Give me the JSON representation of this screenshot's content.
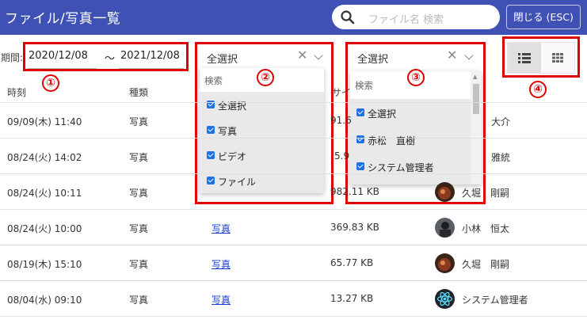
{
  "header": {
    "title": "ファイル/写真一覧",
    "search_placeholder": "ファイル名 検索",
    "close_label": "閉じる (ESC)"
  },
  "filters": {
    "period_label": "期間:",
    "date_from": "2020/12/08",
    "tilde": "～",
    "date_to": "2021/12/08",
    "type_filter": {
      "selected": "全選択",
      "search_placeholder": "検索",
      "options": [
        "全選択",
        "写真",
        "ビデオ",
        "ファイル"
      ]
    },
    "user_filter": {
      "selected": "全選択",
      "search_placeholder": "検索",
      "options": [
        "全選択",
        "赤松　直樹",
        "システム管理者"
      ]
    }
  },
  "annotations": [
    "①",
    "②",
    "③",
    "④"
  ],
  "table": {
    "columns": [
      "時刻",
      "種類",
      "サイ"
    ],
    "rows": [
      {
        "time": "09/09(木) 11:40",
        "type": "写真",
        "link": "",
        "size": "91.6",
        "user": "大介"
      },
      {
        "time": "08/24(火) 14:02",
        "type": "写真",
        "link": "",
        "size": "5.9",
        "user": "雅統"
      },
      {
        "time": "08/24(火) 10:11",
        "type": "写真",
        "link": "",
        "size": "982.11 KB",
        "user": "久堀　剛嗣"
      },
      {
        "time": "08/24(火) 10:00",
        "type": "写真",
        "link": "写真",
        "size": "369.83 KB",
        "user": "小林　恒太"
      },
      {
        "time": "08/19(木) 15:10",
        "type": "写真",
        "link": "写真",
        "size": "65.77 KB",
        "user": "久堀　剛嗣"
      },
      {
        "time": "08/04(水) 09:10",
        "type": "写真",
        "link": "写真",
        "size": "13.27 KB",
        "user": "システム管理者"
      }
    ]
  },
  "colors": {
    "header_bg": "#3f51b5",
    "annotation_red": "#e00000",
    "checkbox_blue": "#1a73e8",
    "link_blue": "#1a3fd4"
  },
  "icons": {
    "search": "search-icon",
    "list_view": "list-view-icon",
    "grid_view": "grid-view-icon",
    "clear": "clear-icon",
    "chevron": "chevron-down-icon"
  }
}
